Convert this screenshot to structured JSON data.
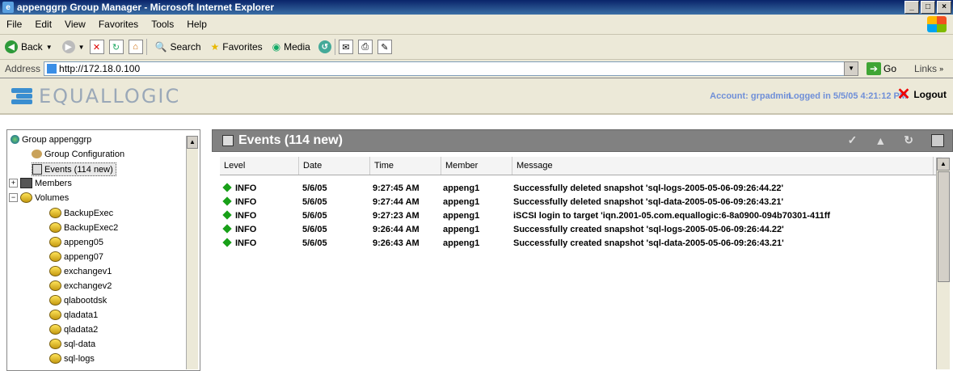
{
  "window": {
    "title": "appenggrp Group Manager - Microsoft Internet Explorer"
  },
  "menu": [
    "File",
    "Edit",
    "View",
    "Favorites",
    "Tools",
    "Help"
  ],
  "toolbar": {
    "back": "Back",
    "search": "Search",
    "favorites": "Favorites",
    "media": "Media"
  },
  "address": {
    "label": "Address",
    "url": "http://172.18.0.100",
    "go": "Go",
    "links": "Links"
  },
  "header": {
    "logo": "EQUALLOGIC",
    "account": "Account: grpadmin",
    "logged_in": "Logged in 5/5/05 4:21:12 PM",
    "logout": "Logout"
  },
  "tree": {
    "group": "Group appenggrp",
    "config": "Group Configuration",
    "events": "Events (114 new)",
    "members": "Members",
    "volumes": "Volumes",
    "volume_items": [
      "BackupExec",
      "BackupExec2",
      "appeng05",
      "appeng07",
      "exchangev1",
      "exchangev2",
      "qlabootdsk",
      "qladata1",
      "qladata2",
      "sql-data",
      "sql-logs"
    ]
  },
  "events": {
    "title": "Events (114 new)",
    "columns": [
      "Level",
      "Date",
      "Time",
      "Member",
      "Message"
    ],
    "rows": [
      {
        "level": "INFO",
        "date": "5/6/05",
        "time": "9:27:45 AM",
        "member": "appeng1",
        "message": "Successfully deleted snapshot 'sql-logs-2005-05-06-09:26:44.22'"
      },
      {
        "level": "INFO",
        "date": "5/6/05",
        "time": "9:27:44 AM",
        "member": "appeng1",
        "message": "Successfully deleted snapshot 'sql-data-2005-05-06-09:26:43.21'"
      },
      {
        "level": "INFO",
        "date": "5/6/05",
        "time": "9:27:23 AM",
        "member": "appeng1",
        "message": "iSCSI login to target 'iqn.2001-05.com.equallogic:6-8a0900-094b70301-411ff"
      },
      {
        "level": "INFO",
        "date": "5/6/05",
        "time": "9:26:44 AM",
        "member": "appeng1",
        "message": "Successfully created snapshot 'sql-logs-2005-05-06-09:26:44.22'"
      },
      {
        "level": "INFO",
        "date": "5/6/05",
        "time": "9:26:43 AM",
        "member": "appeng1",
        "message": "Successfully created snapshot 'sql-data-2005-05-06-09:26:43.21'"
      }
    ]
  }
}
